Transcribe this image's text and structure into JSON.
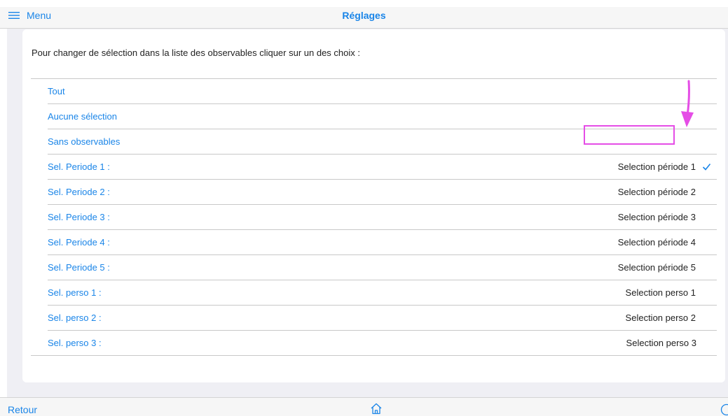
{
  "navbar": {
    "menu_label": "Menu",
    "menu_icon": "hamburger-icon",
    "title": "Réglages"
  },
  "main": {
    "instruction": "Pour changer de sélection dans la liste des observables cliquer sur un des choix :",
    "options": [
      {
        "label": "Tout",
        "value": ""
      },
      {
        "label": "Aucune sélection",
        "value": ""
      },
      {
        "label": "Sans observables",
        "value": ""
      },
      {
        "label": "Sel. Periode 1 :",
        "value": "Selection période 1",
        "checked": true
      },
      {
        "label": "Sel. Periode 2 :",
        "value": "Selection période 2"
      },
      {
        "label": "Sel. Periode 3 :",
        "value": "Selection période 3"
      },
      {
        "label": "Sel. Periode 4 :",
        "value": "Selection période 4"
      },
      {
        "label": "Sel. Periode 5 :",
        "value": "Selection période 5"
      },
      {
        "label": "Sel. perso 1 :",
        "value": "Selection perso 1"
      },
      {
        "label": "Sel. perso 2 :",
        "value": "Selection perso 2"
      },
      {
        "label": "Sel. perso 3 :",
        "value": "Selection perso 3"
      }
    ]
  },
  "bottom_bar": {
    "back_label": "Retour",
    "home_icon": "home-icon",
    "help_icon": "help-icon"
  },
  "colors": {
    "accent": "#1a85e8",
    "annotation": "#e54de6",
    "background": "#efeff4"
  }
}
